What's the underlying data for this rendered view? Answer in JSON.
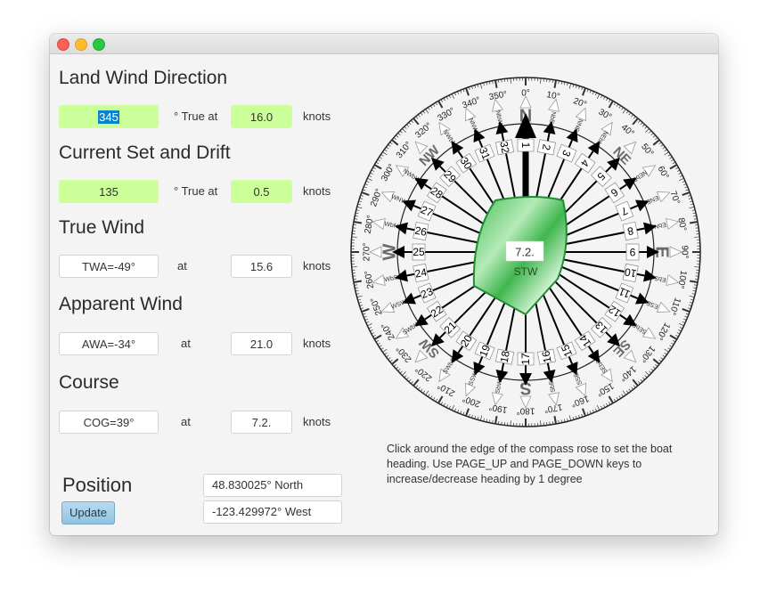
{
  "window": {
    "title": ""
  },
  "land_wind": {
    "heading": "Land Wind Direction",
    "direction": "345",
    "true_at_label": "° True at",
    "speed": "16.0",
    "unit": "knots"
  },
  "current": {
    "heading": "Current Set and Drift",
    "set": "135",
    "true_at_label": "° True at",
    "drift": "0.5",
    "unit": "knots"
  },
  "true_wind": {
    "heading": "True Wind",
    "angle": "TWA=-49°",
    "at_label": "at",
    "speed": "15.6",
    "unit": "knots"
  },
  "apparent_wind": {
    "heading": "Apparent Wind",
    "angle": "AWA=-34°",
    "at_label": "at",
    "speed": "21.0",
    "unit": "knots"
  },
  "course": {
    "heading": "Course",
    "cog": "COG=39°",
    "at_label": "at",
    "speed": "7.2.",
    "unit": "knots"
  },
  "position": {
    "heading": "Position",
    "latitude": "48.830025° North",
    "longitude": "-123.429972° West",
    "update_label": "Update"
  },
  "help_text": "Click around the edge of the compass rose to set the boat heading. Use PAGE_UP and PAGE_DOWN keys to increase/decrease heading by 1 degree",
  "compass": {
    "heading_point": 1,
    "stw_value": "7.2.",
    "stw_label": "STW",
    "cardinals": [
      "N",
      "NE",
      "E",
      "SE",
      "S",
      "SW",
      "W",
      "NW"
    ],
    "points": [
      "N",
      "NbE",
      "NNE",
      "NEbN",
      "NE",
      "NEbE",
      "ENE",
      "EbN",
      "E",
      "EbS",
      "ESE",
      "SEbE",
      "SE",
      "SEbS",
      "SSE",
      "SbE",
      "S",
      "SbW",
      "SSW",
      "SWbS",
      "SW",
      "SWbW",
      "WSW",
      "WbS",
      "W",
      "WbN",
      "WNW",
      "NWbW",
      "NW",
      "NWbN",
      "NNW",
      "NbW"
    ],
    "degree_labels": [
      "0°",
      "10°",
      "20°",
      "30°",
      "40°",
      "50°",
      "60°",
      "70°",
      "80°",
      "90°",
      "100°",
      "110°",
      "120°",
      "130°",
      "140°",
      "150°",
      "160°",
      "170°",
      "180°",
      "190°",
      "200°",
      "210°",
      "220°",
      "230°",
      "240°",
      "250°",
      "260°",
      "270°",
      "280°",
      "290°",
      "300°",
      "310°",
      "320°",
      "330°",
      "340°",
      "350°"
    ],
    "boat_color": "#2db34a"
  }
}
